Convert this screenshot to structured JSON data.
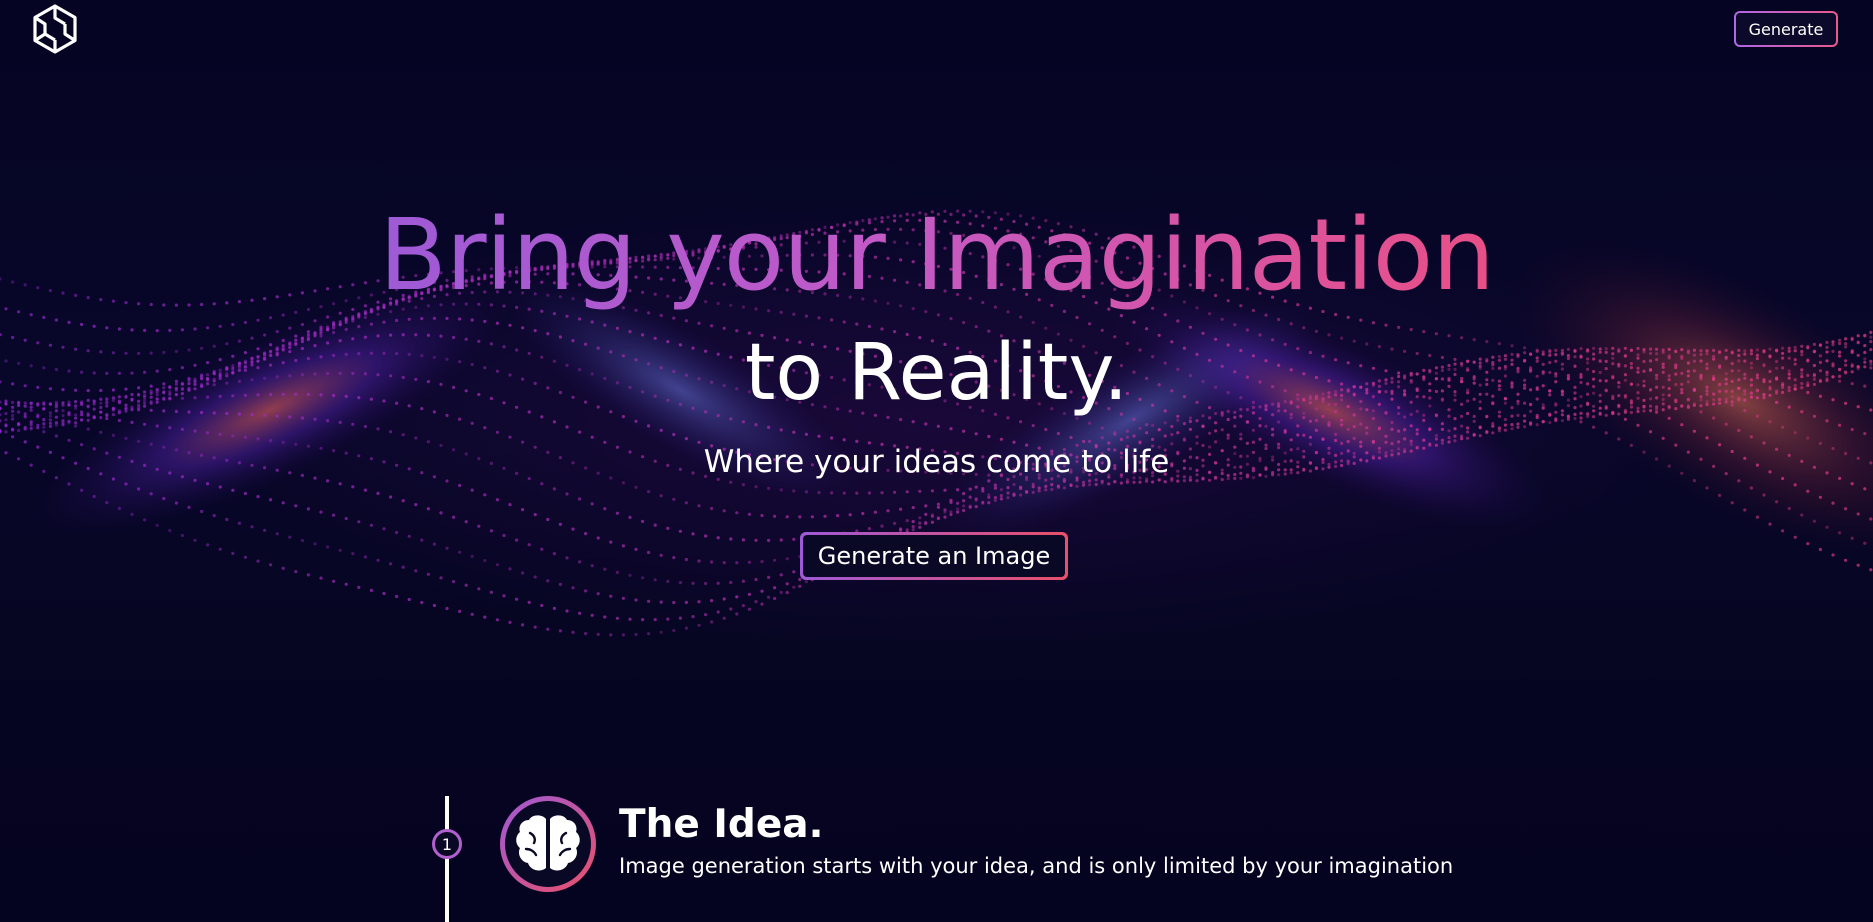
{
  "header": {
    "logo_icon": "hexagon-logo-icon",
    "generate_label": "Generate"
  },
  "hero": {
    "title_line1": "Bring your Imagination",
    "title_line2": "to Reality.",
    "tagline": "Where your ideas come to life",
    "cta_label": "Generate an Image"
  },
  "steps": [
    {
      "number": "1",
      "icon": "brain-icon",
      "title": "The Idea.",
      "description": "Image generation starts with your idea, and is only limited by your imagination"
    }
  ],
  "colors": {
    "background": "#060624",
    "gradient_start": "#9e5ad6",
    "gradient_end": "#e9506a",
    "text": "#ffffff"
  }
}
